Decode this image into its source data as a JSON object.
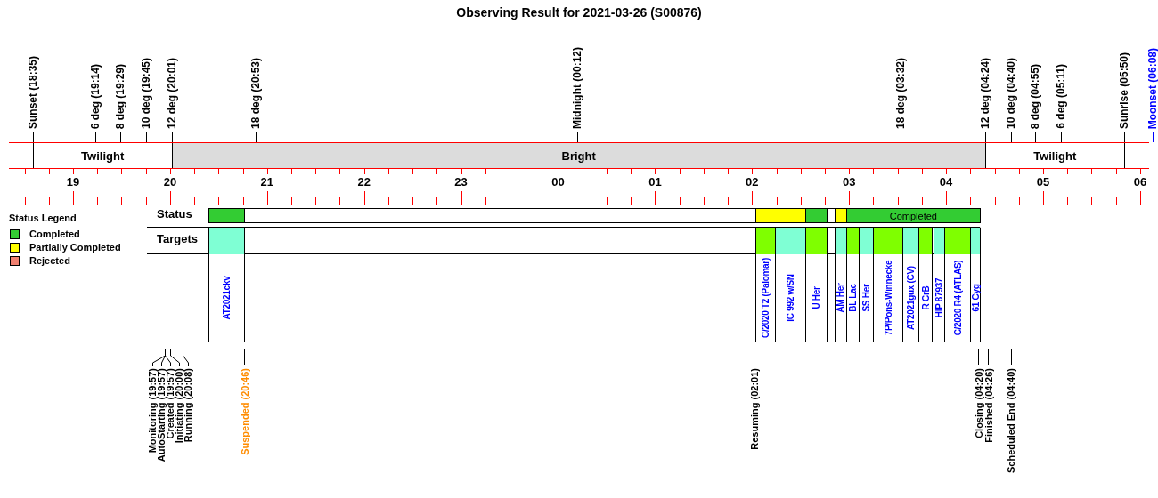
{
  "title": "Observing Result for 2021-03-26 (S00876)",
  "top_events": [
    {
      "label": "Sunset (18:35)",
      "color": "#000000"
    },
    {
      "label": "6 deg (19:14)",
      "color": "#000000"
    },
    {
      "label": "8 deg (19:29)",
      "color": "#000000"
    },
    {
      "label": "10 deg (19:45)",
      "color": "#000000"
    },
    {
      "label": "12 deg (20:01)",
      "color": "#000000"
    },
    {
      "label": "18 deg (20:53)",
      "color": "#000000"
    },
    {
      "label": "Midnight (00:12)",
      "color": "#000000"
    },
    {
      "label": "18 deg (03:32)",
      "color": "#000000"
    },
    {
      "label": "12 deg (04:24)",
      "color": "#000000"
    },
    {
      "label": "10 deg (04:40)",
      "color": "#000000"
    },
    {
      "label": "8 deg (04:55)",
      "color": "#000000"
    },
    {
      "label": "6 deg (05:11)",
      "color": "#000000"
    },
    {
      "label": "Sunrise (05:50)",
      "color": "#000000"
    },
    {
      "label": "Moonset (06:08)",
      "color": "#0000ff"
    }
  ],
  "bands": [
    {
      "kind": "twilight",
      "label": "Twilight"
    },
    {
      "kind": "bright",
      "label": "Bright"
    },
    {
      "kind": "twilight",
      "label": "Twilight"
    }
  ],
  "hours": [
    "19",
    "20",
    "21",
    "22",
    "23",
    "00",
    "01",
    "02",
    "03",
    "04",
    "05",
    "06"
  ],
  "legend": {
    "title": "Status Legend",
    "items": [
      {
        "label": "Completed",
        "color": "#33cc33"
      },
      {
        "label": "Partially Completed",
        "color": "#ffff00"
      },
      {
        "label": "Rejected",
        "color": "#f08070"
      }
    ]
  },
  "status": {
    "label": "Status",
    "segments": [
      {
        "color": "#33cc33"
      },
      {
        "color": "#ffff00"
      },
      {
        "color": "#33cc33"
      },
      {
        "color": "#ffff00"
      },
      {
        "color": "#33cc33",
        "label": "Completed"
      }
    ]
  },
  "targets": {
    "label": "Targets",
    "items": [
      {
        "name": "AT2021ckv",
        "color": "#7fffd4"
      },
      {
        "name": "C/2020 T2 (Palomar)",
        "color": "#7fff00"
      },
      {
        "name": "IC 992 w/SN",
        "color": "#7fffd4"
      },
      {
        "name": "U Her",
        "color": "#7fff00"
      },
      {
        "name": "AM Her",
        "color": "#7fffd4"
      },
      {
        "name": "BL Lac",
        "color": "#7fff00"
      },
      {
        "name": "SS Her",
        "color": "#7fffd4"
      },
      {
        "name": "7P/Pons-Winnecke",
        "color": "#7fff00"
      },
      {
        "name": "AT2021gux (CV)",
        "color": "#7fffd4"
      },
      {
        "name": "R CrB",
        "color": "#7fff00"
      },
      {
        "name": "HIP 87937",
        "color": "#7fffd4"
      },
      {
        "name": "C/2020 R4 (ATLAS)",
        "color": "#7fff00"
      },
      {
        "name": "61 Cyg",
        "color": "#7fffd4"
      }
    ]
  },
  "bottom_events": [
    {
      "label": "Monitoring (19:57)",
      "color": "#000000"
    },
    {
      "label": "AutoStarting (19:57)",
      "color": "#000000"
    },
    {
      "label": "Created (19:57)",
      "color": "#000000"
    },
    {
      "label": "Initiating (20:00)",
      "color": "#000000"
    },
    {
      "label": "Running (20:08)",
      "color": "#000000"
    },
    {
      "label": "Suspended (20:46)",
      "color": "#ff8c00"
    },
    {
      "label": "Resuming (02:01)",
      "color": "#000000"
    },
    {
      "label": "Closing (04:20)",
      "color": "#000000"
    },
    {
      "label": "Finished (04:26)",
      "color": "#000000"
    },
    {
      "label": "Scheduled End (04:40)",
      "color": "#000000"
    }
  ]
}
